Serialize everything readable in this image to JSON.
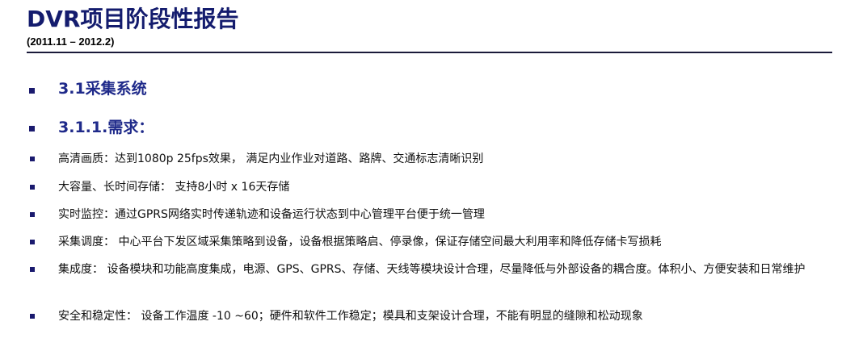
{
  "slide": {
    "title": "DVR项目阶段性报告",
    "date_range": "(2011.11 – 2012.2)",
    "headings": [
      "3.1采集系统",
      "3.1.1.需求："
    ],
    "items": [
      "高清画质：达到1080p 25fps效果， 满足内业作业对道路、路牌、交通标志清晰识别",
      "大容量、长时间存储： 支持8小时 x 16天存储",
      "实时监控：通过GPRS网络实时传递轨迹和设备运行状态到中心管理平台便于统一管理",
      "采集调度： 中心平台下发区域采集策略到设备，设备根据策略启、停录像，保证存储空间最大利用率和降低存储卡写损耗",
      "集成度： 设备模块和功能高度集成，电源、GPS、GPRS、存储、天线等模块设计合理，尽量降低与外部设备的耦合度。体积小、方便安装和日常维护",
      "安全和稳定性： 设备工作温度 -10 ~60；硬件和软件工作稳定；模具和支架设计合理，不能有明显的缝隙和松动现象"
    ]
  }
}
